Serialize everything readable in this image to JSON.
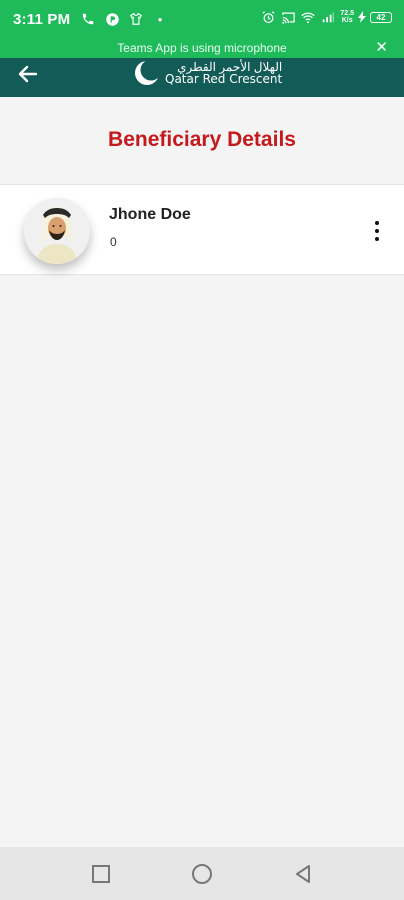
{
  "status_bar": {
    "time": "3:11 PM",
    "dot": "•",
    "speed_value": "72.5",
    "speed_unit": "K/s",
    "battery": "42",
    "icons_left": [
      "phone-icon",
      "app-p-icon",
      "shirt-icon"
    ],
    "icons_right": [
      "alarm-icon",
      "cast-icon",
      "wifi-icon",
      "signal-icon",
      "battery-icon"
    ]
  },
  "notification": {
    "text": "Teams App is using microphone",
    "close": "✕"
  },
  "app_bar": {
    "logo_arabic": "الهلال الأحمر القطري",
    "logo_english": "Qatar Red Crescent"
  },
  "page": {
    "title": "Beneficiary Details"
  },
  "beneficiaries": [
    {
      "name": "Jhone Doe",
      "subtitle": "0",
      "avatar": "man-with-ghutra-avatar"
    }
  ],
  "colors": {
    "status_bar": "#1fbb5b",
    "app_bar": "#135b57",
    "title": "#c41a1e",
    "background": "#f4f4f4"
  }
}
